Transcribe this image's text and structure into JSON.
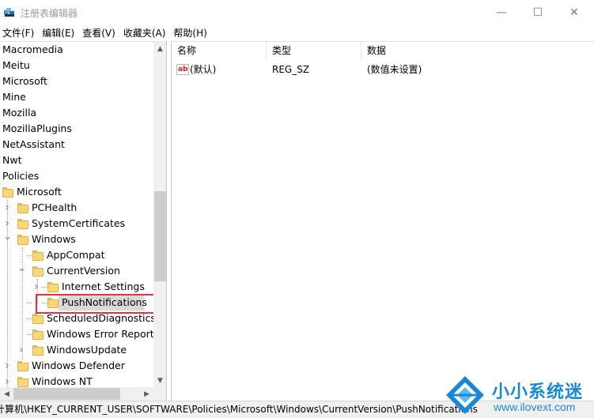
{
  "window": {
    "title": "注册表编辑器",
    "minimize": "—",
    "maximize": "☐",
    "close": "✕"
  },
  "menu": [
    "文件(F)",
    "编辑(E)",
    "查看(V)",
    "收藏夹(A)",
    "帮助(H)"
  ],
  "tree": {
    "items": [
      {
        "label": "Macromedia",
        "level": 0,
        "expander": "",
        "folder": false
      },
      {
        "label": "Meitu",
        "level": 0,
        "expander": "",
        "folder": false
      },
      {
        "label": "Microsoft",
        "level": 0,
        "expander": "",
        "folder": false
      },
      {
        "label": "Mine",
        "level": 0,
        "expander": "",
        "folder": false
      },
      {
        "label": "Mozilla",
        "level": 0,
        "expander": "",
        "folder": false
      },
      {
        "label": "MozillaPlugins",
        "level": 0,
        "expander": "",
        "folder": false
      },
      {
        "label": "NetAssistant",
        "level": 0,
        "expander": "",
        "folder": false
      },
      {
        "label": "Nwt",
        "level": 0,
        "expander": "",
        "folder": false
      },
      {
        "label": "Policies",
        "level": 0,
        "expander": "",
        "folder": false
      },
      {
        "label": "Microsoft",
        "level": 1,
        "expander": "",
        "folder": true
      },
      {
        "label": "PCHealth",
        "level": 2,
        "expander": ">",
        "folder": true
      },
      {
        "label": "SystemCertificates",
        "level": 2,
        "expander": ">",
        "folder": true
      },
      {
        "label": "Windows",
        "level": 2,
        "expander": "v",
        "folder": true
      },
      {
        "label": "AppCompat",
        "level": 3,
        "expander": "",
        "folder": true
      },
      {
        "label": "CurrentVersion",
        "level": 3,
        "expander": "v",
        "folder": true
      },
      {
        "label": "Internet Settings",
        "level": 4,
        "expander": ">",
        "folder": true
      },
      {
        "label": "PushNotifications",
        "level": 4,
        "expander": "",
        "folder": true,
        "selected": true
      },
      {
        "label": "ScheduledDiagnostics",
        "level": 3,
        "expander": "",
        "folder": true
      },
      {
        "label": "Windows Error Reporti",
        "level": 3,
        "expander": "",
        "folder": true
      },
      {
        "label": "WindowsUpdate",
        "level": 3,
        "expander": ">",
        "folder": true
      },
      {
        "label": "Windows Defender",
        "level": 2,
        "expander": ">",
        "folder": true
      },
      {
        "label": "Windows NT",
        "level": 2,
        "expander": ">",
        "folder": true
      }
    ]
  },
  "list": {
    "headers": {
      "name": "名称",
      "type": "类型",
      "data": "数据"
    },
    "rows": [
      {
        "icon": "ab",
        "name": "(默认)",
        "type": "REG_SZ",
        "data": "(数值未设置)"
      }
    ]
  },
  "status": {
    "path": "计算机\\HKEY_CURRENT_USER\\SOFTWARE\\Policies\\Microsoft\\Windows\\CurrentVersion\\PushNotifications"
  },
  "watermark": {
    "brand": "小小系统迷",
    "url": "www.ilovext.com"
  },
  "colors": {
    "highlight": "#e0353b",
    "folder": "#f9d776",
    "watermark": "#1a88d8"
  }
}
